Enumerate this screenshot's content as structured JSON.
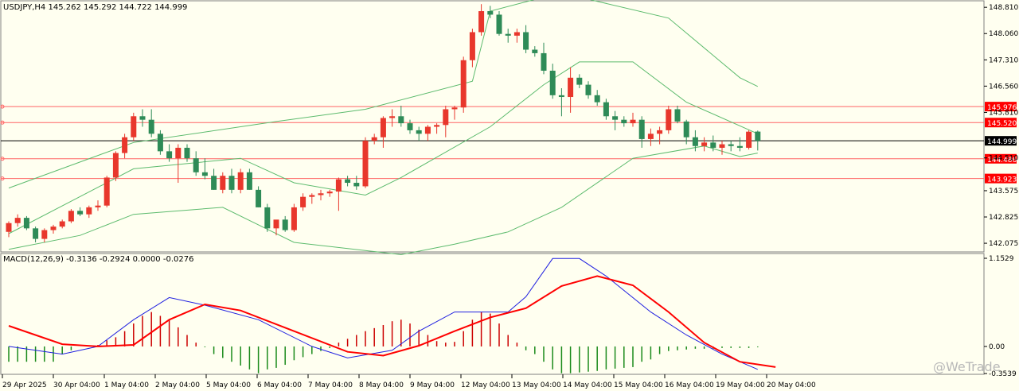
{
  "header": {
    "symbol_line": "USDJPY,H4  145.262 145.292 144.722 144.999",
    "macd_line": "MACD(12,26,9) -0.3136 -0.2924 0.0000 -0.0276"
  },
  "watermark": "@WeTrade",
  "colors": {
    "bull": "#e8372c",
    "bear": "#2e8b57",
    "bands": "#5dbb6e",
    "level_lines": "#ff6464",
    "price_line": "#000000",
    "macd_line": "#2020e0",
    "signal_line": "#ff0000",
    "hist_pos": "#cc0000",
    "hist_neg": "#1a8a1a",
    "background": "#fffff0"
  },
  "chart_data": [
    {
      "type": "candlestick",
      "title": "USDJPY,H4",
      "ylim": [
        141.85,
        148.95
      ],
      "y_ticks": [
        {
          "value": 148.81,
          "label": "148.810"
        },
        {
          "value": 148.06,
          "label": "148.060"
        },
        {
          "value": 147.31,
          "label": "147.310"
        },
        {
          "value": 146.56,
          "label": "146.560"
        },
        {
          "value": 145.81,
          "label": "145.810"
        },
        {
          "value": 144.51,
          "label": "144.510"
        },
        {
          "value": 143.575,
          "label": "143.575"
        },
        {
          "value": 142.825,
          "label": "142.825"
        },
        {
          "value": 142.075,
          "label": "142.075"
        }
      ],
      "levels": [
        {
          "value": 145.976,
          "label": "145.976"
        },
        {
          "value": 145.52,
          "label": "145.520"
        },
        {
          "value": 144.486,
          "label": "144.486"
        },
        {
          "value": 143.923,
          "label": "143.923"
        }
      ],
      "current_price": {
        "value": 144.999,
        "label": "144.999"
      },
      "x_labels": [
        "29 Apr 2025",
        "30 Apr 04:00",
        "1 May 04:00",
        "2 May 04:00",
        "5 May 04:00",
        "6 May 04:00",
        "7 May 04:00",
        "8 May 04:00",
        "9 May 04:00",
        "12 May 04:00",
        "13 May 04:00",
        "14 May 04:00",
        "15 May 04:00",
        "16 May 04:00",
        "19 May 04:00",
        "20 May 04:00"
      ],
      "candles": [
        [
          142.4,
          142.7,
          142.25,
          142.65
        ],
        [
          142.65,
          142.9,
          142.55,
          142.8
        ],
        [
          142.8,
          142.85,
          142.45,
          142.5
        ],
        [
          142.5,
          142.55,
          142.1,
          142.2
        ],
        [
          142.2,
          142.5,
          142.1,
          142.45
        ],
        [
          142.45,
          142.6,
          142.35,
          142.55
        ],
        [
          142.55,
          142.75,
          142.5,
          142.7
        ],
        [
          142.7,
          143.05,
          142.65,
          143.0
        ],
        [
          143.0,
          143.1,
          142.85,
          142.9
        ],
        [
          142.9,
          143.15,
          142.8,
          143.1
        ],
        [
          143.1,
          143.3,
          143.0,
          143.15
        ],
        [
          143.15,
          144.0,
          143.1,
          143.95
        ],
        [
          143.95,
          144.7,
          143.85,
          144.65
        ],
        [
          144.65,
          145.2,
          144.5,
          145.1
        ],
        [
          145.1,
          145.8,
          145.0,
          145.7
        ],
        [
          145.7,
          145.9,
          145.4,
          145.6
        ],
        [
          145.6,
          145.9,
          145.1,
          145.2
        ],
        [
          145.2,
          145.3,
          144.6,
          144.7
        ],
        [
          144.7,
          144.9,
          144.4,
          144.5
        ],
        [
          144.5,
          144.9,
          143.8,
          144.8
        ],
        [
          144.8,
          144.9,
          144.4,
          144.5
        ],
        [
          144.5,
          144.7,
          144.0,
          144.1
        ],
        [
          144.1,
          144.5,
          143.9,
          144.0
        ],
        [
          144.0,
          144.2,
          143.6,
          143.6
        ],
        [
          143.6,
          144.1,
          143.5,
          144.0
        ],
        [
          144.0,
          144.2,
          143.5,
          143.6
        ],
        [
          143.6,
          144.2,
          143.5,
          144.1
        ],
        [
          144.1,
          144.2,
          143.6,
          143.6
        ],
        [
          143.6,
          143.7,
          143.1,
          143.1
        ],
        [
          143.1,
          143.2,
          142.4,
          142.5
        ],
        [
          142.5,
          142.7,
          142.3,
          142.75
        ],
        [
          142.75,
          142.85,
          142.4,
          142.45
        ],
        [
          142.45,
          143.2,
          142.4,
          143.1
        ],
        [
          143.1,
          143.5,
          143.0,
          143.4
        ],
        [
          143.4,
          143.5,
          143.2,
          143.45
        ],
        [
          143.45,
          143.6,
          143.3,
          143.5
        ],
        [
          143.5,
          143.6,
          143.4,
          143.55
        ],
        [
          143.55,
          143.95,
          143.0,
          143.9
        ],
        [
          143.9,
          144.0,
          143.7,
          143.8
        ],
        [
          143.8,
          144.0,
          143.6,
          143.7
        ],
        [
          143.7,
          145.1,
          143.65,
          145.0
        ],
        [
          145.0,
          145.2,
          144.9,
          145.1
        ],
        [
          145.1,
          145.7,
          144.8,
          145.65
        ],
        [
          145.65,
          145.9,
          145.4,
          145.7
        ],
        [
          145.7,
          146.0,
          145.4,
          145.5
        ],
        [
          145.5,
          145.6,
          145.2,
          145.3
        ],
        [
          145.3,
          145.4,
          145.0,
          145.2
        ],
        [
          145.2,
          145.45,
          145.0,
          145.4
        ],
        [
          145.4,
          145.5,
          145.2,
          145.45
        ],
        [
          145.45,
          146.0,
          145.1,
          145.9
        ],
        [
          145.9,
          146.0,
          145.6,
          145.95
        ],
        [
          145.95,
          147.4,
          145.8,
          147.3
        ],
        [
          147.3,
          148.2,
          147.1,
          148.1
        ],
        [
          148.1,
          148.9,
          148.0,
          148.7
        ],
        [
          148.7,
          148.85,
          148.5,
          148.6
        ],
        [
          148.6,
          148.7,
          148.0,
          148.05
        ],
        [
          148.05,
          148.2,
          147.8,
          148.0
        ],
        [
          148.0,
          148.2,
          147.8,
          148.1
        ],
        [
          148.1,
          148.3,
          147.5,
          147.6
        ],
        [
          147.6,
          147.7,
          147.4,
          147.5
        ],
        [
          147.5,
          147.8,
          146.9,
          147.0
        ],
        [
          147.0,
          147.2,
          146.2,
          146.3
        ],
        [
          146.3,
          146.5,
          145.7,
          146.25
        ],
        [
          146.25,
          147.1,
          145.8,
          146.8
        ],
        [
          146.8,
          146.9,
          146.5,
          146.6
        ],
        [
          146.6,
          146.7,
          146.2,
          146.3
        ],
        [
          146.3,
          146.45,
          146.0,
          146.1
        ],
        [
          146.1,
          146.2,
          145.6,
          145.7
        ],
        [
          145.7,
          145.85,
          145.3,
          145.6
        ],
        [
          145.6,
          145.7,
          145.4,
          145.5
        ],
        [
          145.5,
          145.8,
          145.4,
          145.6
        ],
        [
          145.6,
          145.7,
          144.8,
          145.05
        ],
        [
          145.05,
          145.35,
          144.85,
          145.2
        ],
        [
          145.2,
          145.4,
          144.9,
          145.3
        ],
        [
          145.3,
          146.0,
          145.2,
          145.9
        ],
        [
          145.9,
          146.0,
          145.5,
          145.55
        ],
        [
          145.55,
          145.6,
          144.9,
          145.1
        ],
        [
          145.1,
          145.3,
          144.7,
          144.85
        ],
        [
          144.85,
          145.1,
          144.7,
          144.95
        ],
        [
          144.95,
          145.15,
          144.7,
          144.8
        ],
        [
          144.8,
          145.0,
          144.6,
          144.9
        ],
        [
          144.9,
          145.0,
          144.7,
          144.85
        ],
        [
          144.85,
          145.1,
          144.7,
          144.8
        ],
        [
          144.8,
          145.3,
          144.75,
          145.26
        ],
        [
          145.262,
          145.292,
          144.722,
          144.999
        ]
      ],
      "bands_upper": [
        [
          0,
          143.65
        ],
        [
          14,
          144.95
        ],
        [
          30,
          145.55
        ],
        [
          40,
          145.9
        ],
        [
          52,
          146.7
        ],
        [
          54,
          148.7
        ],
        [
          60,
          149.1
        ],
        [
          64,
          149.1
        ],
        [
          74,
          148.5
        ],
        [
          82,
          146.8
        ],
        [
          84,
          146.55
        ]
      ],
      "bands_middle": [
        [
          0,
          142.35
        ],
        [
          14,
          144.2
        ],
        [
          26,
          144.5
        ],
        [
          32,
          143.8
        ],
        [
          40,
          143.45
        ],
        [
          44,
          143.95
        ],
        [
          54,
          145.4
        ],
        [
          60,
          146.6
        ],
        [
          64,
          147.25
        ],
        [
          70,
          147.25
        ],
        [
          76,
          146.1
        ],
        [
          84,
          145.2
        ]
      ],
      "bands_lower": [
        [
          0,
          141.9
        ],
        [
          8,
          142.3
        ],
        [
          14,
          142.9
        ],
        [
          24,
          143.1
        ],
        [
          28,
          142.6
        ],
        [
          32,
          142.1
        ],
        [
          44,
          141.75
        ],
        [
          50,
          142.05
        ],
        [
          56,
          142.4
        ],
        [
          62,
          143.1
        ],
        [
          70,
          144.5
        ],
        [
          78,
          144.85
        ],
        [
          80,
          144.7
        ],
        [
          82,
          144.55
        ],
        [
          84,
          144.65
        ]
      ]
    },
    {
      "type": "line",
      "title": "MACD(12,26,9)",
      "ylim": [
        -0.3539,
        1.1529
      ],
      "y_ticks": [
        {
          "value": 1.1529,
          "label": "1.1529"
        },
        {
          "value": 0.0,
          "label": "0.00"
        },
        {
          "value": -0.3539,
          "label": "-0.3539"
        }
      ],
      "series": [
        {
          "name": "MACD",
          "points": [
            [
              0,
              0.0
            ],
            [
              6,
              -0.1
            ],
            [
              10,
              0.0
            ],
            [
              14,
              0.35
            ],
            [
              18,
              0.64
            ],
            [
              22,
              0.54
            ],
            [
              28,
              0.35
            ],
            [
              34,
              0.0
            ],
            [
              38,
              -0.15
            ],
            [
              43,
              -0.05
            ],
            [
              46,
              0.2
            ],
            [
              50,
              0.45
            ],
            [
              56,
              0.45
            ],
            [
              58,
              0.65
            ],
            [
              61,
              1.15
            ],
            [
              64,
              1.15
            ],
            [
              67,
              0.92
            ],
            [
              72,
              0.45
            ],
            [
              76,
              0.15
            ],
            [
              80,
              -0.1
            ],
            [
              84,
              -0.3
            ]
          ]
        },
        {
          "name": "Signal",
          "points": [
            [
              0,
              0.27
            ],
            [
              6,
              0.03
            ],
            [
              10,
              0.0
            ],
            [
              14,
              0.02
            ],
            [
              18,
              0.35
            ],
            [
              22,
              0.55
            ],
            [
              26,
              0.47
            ],
            [
              32,
              0.2
            ],
            [
              38,
              -0.07
            ],
            [
              42,
              -0.12
            ],
            [
              46,
              0.01
            ],
            [
              50,
              0.2
            ],
            [
              54,
              0.38
            ],
            [
              58,
              0.5
            ],
            [
              62,
              0.79
            ],
            [
              66,
              0.92
            ],
            [
              70,
              0.8
            ],
            [
              74,
              0.45
            ],
            [
              78,
              0.05
            ],
            [
              82,
              -0.2
            ],
            [
              86,
              -0.27
            ]
          ]
        }
      ],
      "histogram": [
        -0.2,
        -0.2,
        -0.2,
        -0.2,
        -0.2,
        -0.2,
        -0.1,
        -0.05,
        0.0,
        0.0,
        0.02,
        0.08,
        0.12,
        0.2,
        0.3,
        0.4,
        0.45,
        0.4,
        0.35,
        0.25,
        0.15,
        0.05,
        -0.01,
        -0.1,
        -0.15,
        -0.2,
        -0.25,
        -0.3,
        -0.35,
        -0.3,
        -0.28,
        -0.24,
        -0.18,
        -0.14,
        -0.1,
        -0.06,
        -0.02,
        0.05,
        0.1,
        0.15,
        0.2,
        0.24,
        0.28,
        0.33,
        0.35,
        0.3,
        0.22,
        0.15,
        0.07,
        0.05,
        0.06,
        0.2,
        0.35,
        0.45,
        0.43,
        0.3,
        0.15,
        0.05,
        -0.05,
        -0.1,
        -0.2,
        -0.3,
        -0.35,
        -0.35,
        -0.34,
        -0.33,
        -0.32,
        -0.3,
        -0.29,
        -0.28,
        -0.27,
        -0.2,
        -0.17,
        -0.1,
        -0.06,
        -0.05,
        -0.04,
        -0.03,
        -0.03,
        -0.03,
        -0.02,
        -0.02,
        -0.02,
        -0.02,
        -0.01
      ]
    }
  ]
}
